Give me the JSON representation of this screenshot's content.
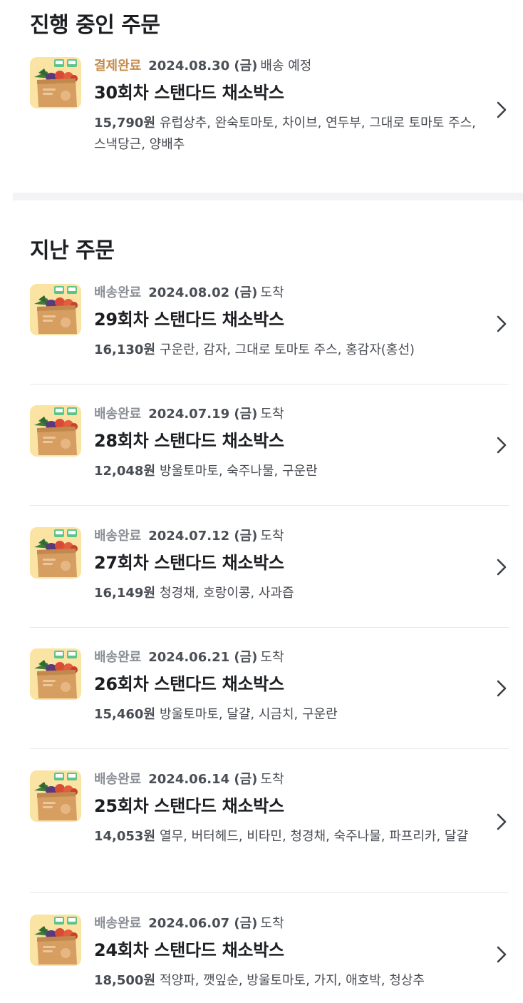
{
  "sections": {
    "ongoing_title": "진행 중인 주문",
    "past_title": "지난 주문"
  },
  "colors": {
    "status_paid": "#c58a49",
    "status_delivered": "#8b8f96",
    "divider": "#f3f3f5"
  },
  "thumbnail_icon": "vegetable-box-icon",
  "chevron_icon": "chevron-right-icon",
  "ongoing": [
    {
      "status": "결제완료",
      "date": "2024.08.30 (금)",
      "date_suffix": "배송 예정",
      "name": "30회차 스탠다드 채소박스",
      "price": "15,790원",
      "items": "유럽상추, 완숙토마토, 차이브, 연두부, 그대로 토마토 주스, 스낵당근, 양배추"
    }
  ],
  "past": [
    {
      "status": "배송완료",
      "date": "2024.08.02 (금)",
      "date_suffix": "도착",
      "name": "29회차 스탠다드 채소박스",
      "price": "16,130원",
      "items": "구운란, 감자, 그대로 토마토 주스, 홍감자(홍선)"
    },
    {
      "status": "배송완료",
      "date": "2024.07.19 (금)",
      "date_suffix": "도착",
      "name": "28회차 스탠다드 채소박스",
      "price": "12,048원",
      "items": "방울토마토, 숙주나물, 구운란"
    },
    {
      "status": "배송완료",
      "date": "2024.07.12 (금)",
      "date_suffix": "도착",
      "name": "27회차 스탠다드 채소박스",
      "price": "16,149원",
      "items": "청경채, 호랑이콩, 사과즙"
    },
    {
      "status": "배송완료",
      "date": "2024.06.21 (금)",
      "date_suffix": "도착",
      "name": "26회차 스탠다드 채소박스",
      "price": "15,460원",
      "items": "방울토마토, 달걀, 시금치, 구운란"
    },
    {
      "status": "배송완료",
      "date": "2024.06.14 (금)",
      "date_suffix": "도착",
      "name": "25회차 스탠다드 채소박스",
      "price": "14,053원",
      "items": "열무, 버터헤드, 비타민, 청경채, 숙주나물, 파프리카, 달걀"
    },
    {
      "status": "배송완료",
      "date": "2024.06.07 (금)",
      "date_suffix": "도착",
      "name": "24회차 스탠다드 채소박스",
      "price": "18,500원",
      "items": "적양파, 깻잎순, 방울토마토, 가지, 애호박, 청상추"
    }
  ]
}
